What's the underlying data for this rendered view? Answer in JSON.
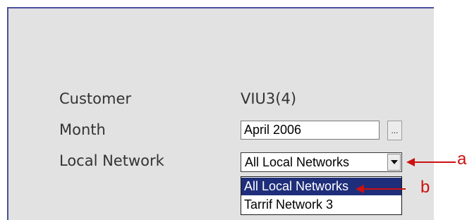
{
  "form": {
    "customer_label": "Customer",
    "customer_value": "VIU3(4)",
    "month_label": "Month",
    "month_value": "April 2006",
    "month_picker_label": "...",
    "network_label": "Local Network",
    "network_selected": "All Local Networks",
    "network_options": [
      "All Local Networks",
      "Tarrif Network 3"
    ]
  },
  "callouts": {
    "a": "a",
    "b": "b"
  },
  "colors": {
    "panel_bg": "#e2e2e2",
    "panel_border": "#4a4f9e",
    "highlight": "#1f2e7a",
    "callout": "#cc1111"
  }
}
